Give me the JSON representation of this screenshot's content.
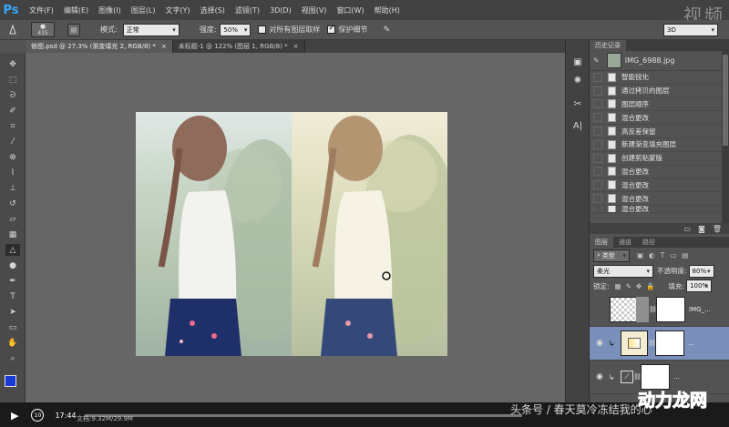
{
  "app": {
    "logo": "Ps"
  },
  "menu": [
    "文件(F)",
    "编辑(E)",
    "图像(I)",
    "图层(L)",
    "文字(Y)",
    "选择(S)",
    "滤镜(T)",
    "3D(D)",
    "视图(V)",
    "窗口(W)",
    "帮助(H)"
  ],
  "top_watermark": "视频",
  "options": {
    "brush_size": "415",
    "mode_label": "模式:",
    "mode_value": "正常",
    "strength_label": "强度:",
    "strength_value": "50%",
    "sample_all_label": "对所有图层取样",
    "protect_detail_label": "保护细节",
    "protect_detail_checked": true,
    "workspace": "3D"
  },
  "tabs": [
    {
      "label": "修图.psd @ 27.3% (渐变填充 2, RGB/8) *",
      "active": true
    },
    {
      "label": "未标题-1 @ 122% (图层 1, RGB/8) *",
      "active": false
    }
  ],
  "history": {
    "title": "历史记录",
    "snapshot": "IMG_6988.jpg",
    "items": [
      "智能锐化",
      "通过拷贝的图层",
      "图层顺序",
      "混合更改",
      "高反差保留",
      "新建渐变填充图层",
      "创建剪贴蒙版",
      "混合更改",
      "混合更改",
      "混合更改",
      "混合更改"
    ]
  },
  "layers": {
    "tabs": [
      "图层",
      "通道",
      "路径"
    ],
    "filter": "类型",
    "blend_mode": "柔光",
    "opacity_label": "不透明度:",
    "opacity_value": "80%",
    "lock_label": "锁定:",
    "fill_label": "填充:",
    "fill_value": "100%",
    "rows": [
      {
        "name": "IMG_...",
        "selected": false
      },
      {
        "name": "...",
        "selected": true
      },
      {
        "name": "...",
        "selected": false
      }
    ]
  },
  "status": {
    "doc": "文档:9.32M/29.9M"
  },
  "player": {
    "time": "17:44",
    "progress": 0.0
  },
  "overlay": {
    "bottom_text": "头条号 / 春天莫冷冻结我的心",
    "logo": "动力龙网"
  }
}
